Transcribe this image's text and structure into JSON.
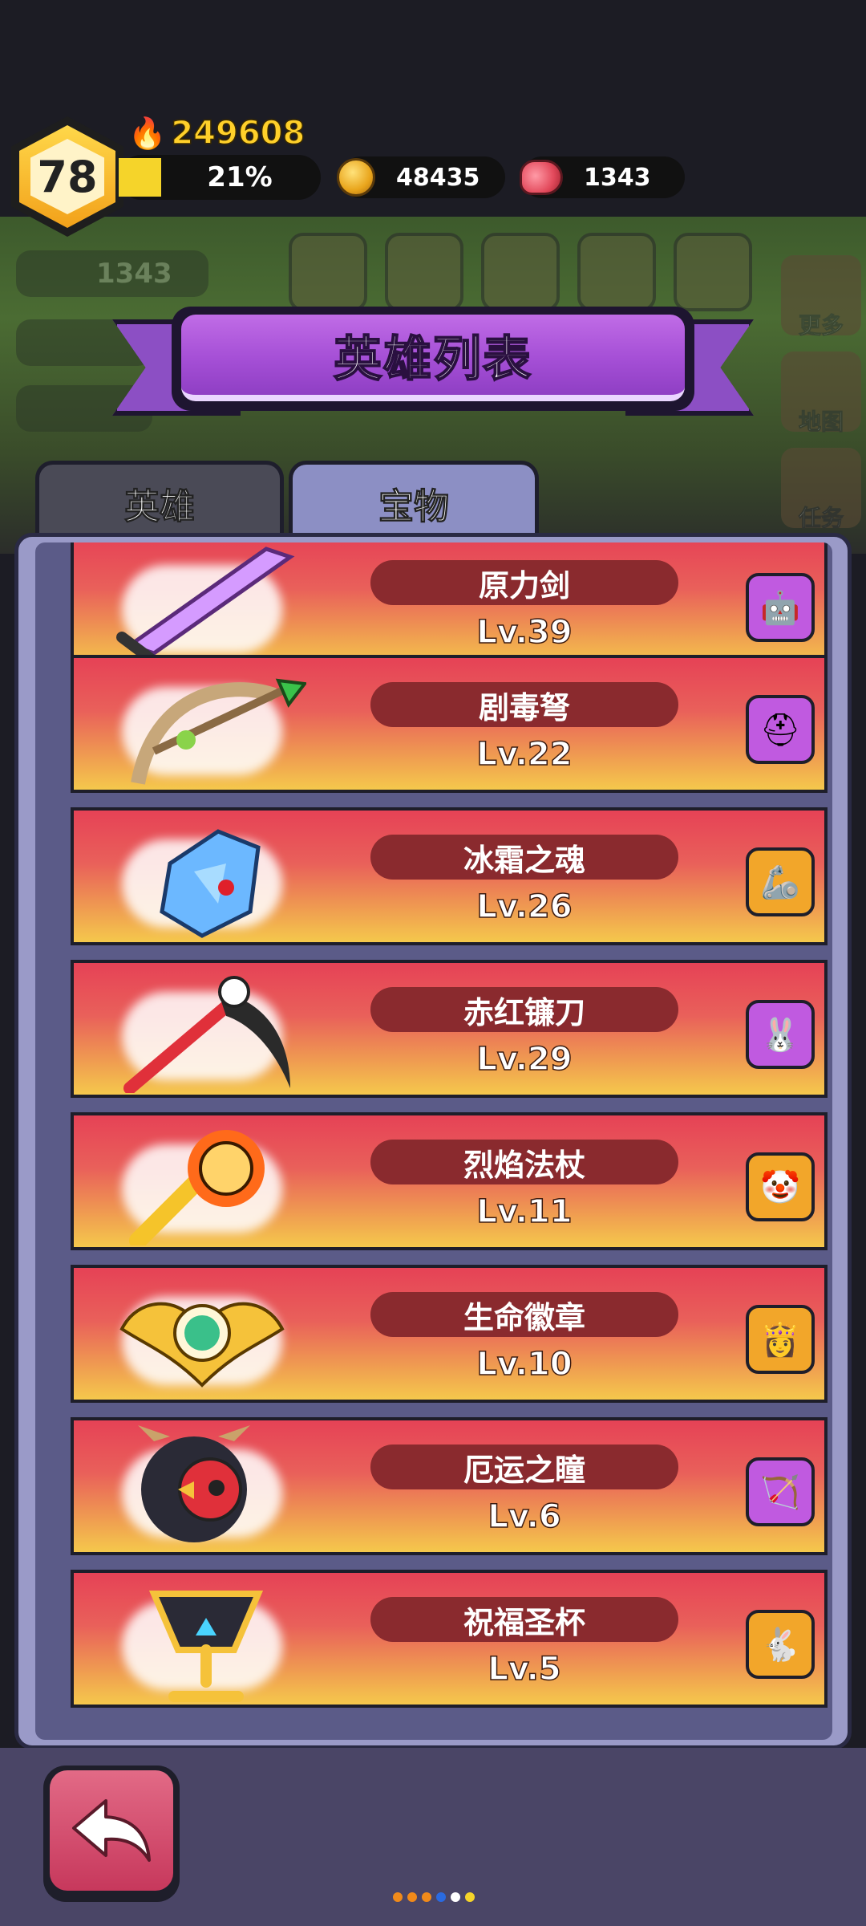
{
  "hud": {
    "level": "78",
    "power": "249608",
    "xp_percent_label": "21%",
    "xp_fraction": 0.21,
    "gold": "48435",
    "meat": "1343"
  },
  "background": {
    "meat_count": "1343",
    "side_buttons": [
      "更多",
      "地图",
      "任务"
    ]
  },
  "title": "英雄列表",
  "tabs": [
    {
      "label": "英雄",
      "active": false
    },
    {
      "label": "宝物",
      "active": true
    }
  ],
  "treasures": [
    {
      "name": "原力剑",
      "level": "Lv.39",
      "art_icon": "sword-icon",
      "hero_icon": "robot-hero-icon"
    },
    {
      "name": "剧毒弩",
      "level": "Lv.22",
      "art_icon": "crossbow-icon",
      "hero_icon": "knight-hero-icon"
    },
    {
      "name": "冰霜之魂",
      "level": "Lv.26",
      "art_icon": "ice-crystal-icon",
      "hero_icon": "mech-hero-icon"
    },
    {
      "name": "赤红镰刀",
      "level": "Lv.29",
      "art_icon": "scythe-icon",
      "hero_icon": "bunny-hero-icon"
    },
    {
      "name": "烈焰法杖",
      "level": "Lv.11",
      "art_icon": "fire-staff-icon",
      "hero_icon": "jester-hero-icon"
    },
    {
      "name": "生命徽章",
      "level": "Lv.10",
      "art_icon": "winged-badge-icon",
      "hero_icon": "paladin-hero-icon"
    },
    {
      "name": "厄运之瞳",
      "level": "Lv.6",
      "art_icon": "bird-eye-icon",
      "hero_icon": "ranger-hero-icon"
    },
    {
      "name": "祝福圣杯",
      "level": "Lv.5",
      "art_icon": "chalice-icon",
      "hero_icon": "rabbit-hero-icon"
    }
  ],
  "page_indicator": {
    "count": 6,
    "active": 3
  },
  "colors": {
    "accent_purple": "#a54fd6",
    "card_top": "#e64256",
    "card_bottom": "#f5c84c",
    "gold_text": "#ffd02a"
  }
}
